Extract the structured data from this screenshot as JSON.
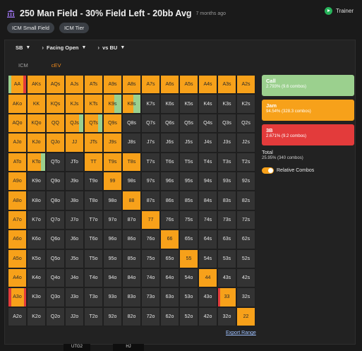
{
  "header": {
    "title": "250 Man Field - 30% Field Left - 20bb Avg",
    "time": "7 months ago",
    "trainer_label": "Trainer"
  },
  "chips": [
    "ICM Small Field",
    "ICM Tier"
  ],
  "selectors": {
    "position": "SB",
    "action": "Facing Open",
    "vs": "vs BU"
  },
  "tabs": [
    "ICM",
    "cEV"
  ],
  "colors": {
    "jam": "#f7a11a",
    "call": "#9bd08e",
    "three_bet": "#e33b3b",
    "fold": "#333333"
  },
  "grid": {
    "rows": [
      [
        "AA",
        "AKs",
        "AQs",
        "AJs",
        "ATs",
        "A9s",
        "A8s",
        "A7s",
        "A6s",
        "A5s",
        "A4s",
        "A3s",
        "A2s"
      ],
      [
        "AKo",
        "KK",
        "KQs",
        "KJs",
        "KTs",
        "K9s",
        "K8s",
        "K7s",
        "K6s",
        "K5s",
        "K4s",
        "K3s",
        "K2s"
      ],
      [
        "AQo",
        "KQo",
        "QQ",
        "QJs",
        "QTs",
        "Q9s",
        "Q8s",
        "Q7s",
        "Q6s",
        "Q5s",
        "Q4s",
        "Q3s",
        "Q2s"
      ],
      [
        "AJo",
        "KJo",
        "QJo",
        "JJ",
        "JTs",
        "J9s",
        "J8s",
        "J7s",
        "J6s",
        "J5s",
        "J4s",
        "J3s",
        "J2s"
      ],
      [
        "ATo",
        "KTo",
        "QTo",
        "JTo",
        "TT",
        "T9s",
        "T8s",
        "T7s",
        "T6s",
        "T5s",
        "T4s",
        "T3s",
        "T2s"
      ],
      [
        "A9o",
        "K9o",
        "Q9o",
        "J9o",
        "T9o",
        "99",
        "98s",
        "97s",
        "96s",
        "95s",
        "94s",
        "93s",
        "92s"
      ],
      [
        "A8o",
        "K8o",
        "Q8o",
        "J8o",
        "T8o",
        "98o",
        "88",
        "87s",
        "86s",
        "85s",
        "84s",
        "83s",
        "82s"
      ],
      [
        "A7o",
        "K7o",
        "Q7o",
        "J7o",
        "T7o",
        "97o",
        "87o",
        "77",
        "76s",
        "75s",
        "74s",
        "73s",
        "72s"
      ],
      [
        "A6o",
        "K6o",
        "Q6o",
        "J6o",
        "T6o",
        "96o",
        "86o",
        "76o",
        "66",
        "65s",
        "64s",
        "63s",
        "62s"
      ],
      [
        "A5o",
        "K5o",
        "Q5o",
        "J5o",
        "T5o",
        "95o",
        "85o",
        "75o",
        "65o",
        "55",
        "54s",
        "53s",
        "52s"
      ],
      [
        "A4o",
        "K4o",
        "Q4o",
        "J4o",
        "T4o",
        "94o",
        "84o",
        "74o",
        "64o",
        "54o",
        "44",
        "43s",
        "42s"
      ],
      [
        "A3o",
        "K3o",
        "Q3o",
        "J3o",
        "T3o",
        "93o",
        "83o",
        "73o",
        "63o",
        "53o",
        "43o",
        "33",
        "32s"
      ],
      [
        "A2o",
        "K2o",
        "Q2o",
        "J2o",
        "T2o",
        "92o",
        "82o",
        "72o",
        "62o",
        "52o",
        "42o",
        "32o",
        "22"
      ]
    ],
    "actions": [
      [
        "X",
        "J",
        "J",
        "J",
        "J",
        "J",
        "J",
        "J",
        "J",
        "J",
        "J",
        "J",
        "J"
      ],
      [
        "J",
        "J",
        "J",
        "J",
        "J",
        "Kc",
        "Kc",
        "F",
        "F",
        "F",
        "F",
        "F",
        "F"
      ],
      [
        "J",
        "J",
        "J",
        "Jc",
        "Jc",
        "J",
        "F",
        "F",
        "F",
        "F",
        "F",
        "F",
        "F"
      ],
      [
        "J",
        "J",
        "J",
        "J",
        "J",
        "J",
        "F",
        "F",
        "F",
        "F",
        "F",
        "F",
        "F"
      ],
      [
        "J",
        "Jc",
        "F",
        "F",
        "J",
        "J",
        "J",
        "F",
        "F",
        "F",
        "F",
        "F",
        "F"
      ],
      [
        "J",
        "F",
        "F",
        "F",
        "F",
        "J",
        "F",
        "F",
        "F",
        "F",
        "F",
        "F",
        "F"
      ],
      [
        "J",
        "F",
        "F",
        "F",
        "F",
        "F",
        "J",
        "F",
        "F",
        "F",
        "F",
        "F",
        "F"
      ],
      [
        "J",
        "F",
        "F",
        "F",
        "F",
        "F",
        "F",
        "J",
        "F",
        "F",
        "F",
        "F",
        "F"
      ],
      [
        "J",
        "F",
        "F",
        "F",
        "F",
        "F",
        "F",
        "F",
        "J",
        "F",
        "F",
        "F",
        "F"
      ],
      [
        "J",
        "F",
        "F",
        "F",
        "F",
        "F",
        "F",
        "F",
        "F",
        "J",
        "F",
        "F",
        "F"
      ],
      [
        "J",
        "F",
        "F",
        "F",
        "F",
        "F",
        "F",
        "F",
        "F",
        "F",
        "J",
        "F",
        "F"
      ],
      [
        "F3",
        "F",
        "F",
        "F",
        "F",
        "F",
        "F",
        "F",
        "F",
        "F",
        "F",
        "J3",
        "F"
      ],
      [
        "F",
        "F",
        "F",
        "F",
        "F",
        "F",
        "F",
        "F",
        "F",
        "F",
        "F",
        "F",
        "J"
      ]
    ]
  },
  "legend": {
    "call": {
      "name": "Call",
      "stat": "2.793% (9.6 combos)"
    },
    "jam": {
      "name": "Jam",
      "stat": "94.54% (328.3 combos)"
    },
    "three_bet": {
      "name": "3B",
      "stat": "2.671% (9.2 combos)"
    },
    "total": {
      "name": "Total",
      "stat": "25.95% (340 combos)"
    },
    "relative_label": "Relative Combos"
  },
  "export_label": "Export Range",
  "bottom_chips": [
    "UTG2",
    "HJ"
  ]
}
